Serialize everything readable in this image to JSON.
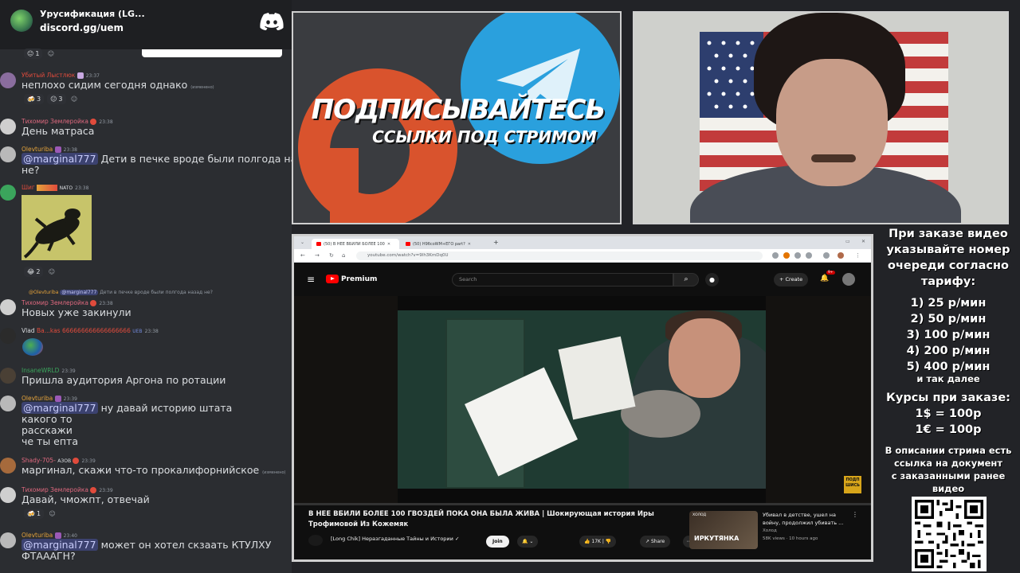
{
  "discord": {
    "server_name": "Урусификация (LG...",
    "invite": "discord.gg/uem",
    "top_reactions": [
      {
        "emoji": "😐",
        "count": "1"
      }
    ],
    "messages": [
      {
        "username": "Убитый Лыстлюк",
        "username_color": "#e04b3c",
        "time": "23:37",
        "text": "неплохо сидим сегодня однако",
        "edited": "(изменено)",
        "reactions": [
          {
            "emoji": "🍻",
            "count": "3"
          },
          {
            "emoji": "😐",
            "count": "3"
          }
        ]
      },
      {
        "username": "Тихомир Землеройка",
        "username_color": "#e0697f",
        "time": "23:38",
        "text": "День матраса"
      },
      {
        "username": "Olevturiba",
        "username_color": "#e5a33b",
        "time": "23:38",
        "mention": "@marginal777",
        "text_line1": "Дети в печке вроде были полгода назад",
        "text_line2": "не?"
      },
      {
        "username": "Шиг",
        "username_color": "#e04b3c",
        "badge": "NATO",
        "time": "23:38",
        "reactions": [
          {
            "emoji": "😂",
            "count": "2"
          }
        ]
      },
      {
        "reply_user": "@Olevturiba",
        "reply_mention": "@marginal777",
        "reply_text": "Дети в печке вроде были полгода назад не?",
        "username": "Тихомир Землеройка",
        "username_color": "#e0697f",
        "time": "23:38",
        "text": "Новых уже закинули"
      },
      {
        "username": "Vlad",
        "username_color": "#dbdee1",
        "username_suffix": "Ba...kas 666666666666666666",
        "badge": "UEB",
        "time": "23:38"
      },
      {
        "username": "InsaneWRLD",
        "username_color": "#3ba55c",
        "time": "23:39",
        "text": "Пришла аудитория Аргона по ротации"
      },
      {
        "username": "Olevturiba",
        "username_color": "#e5a33b",
        "time": "23:39",
        "mention": "@marginal777",
        "text_line1": "ну давай историю штата",
        "text_line2": "какого то",
        "text_line3": "расскажи",
        "text_line4": "че ты епта"
      },
      {
        "username": "Shady-705-",
        "username_color": "#e0697f",
        "badge": "АЗОВ",
        "time": "23:39",
        "text": "маргинал, скажи что-то прокалифорнийское",
        "edited": "(изменено)"
      },
      {
        "username": "Тихомир Землеройка",
        "username_color": "#e0697f",
        "time": "23:39",
        "text": "Давай, чможпт, отвечай",
        "reactions": [
          {
            "emoji": "🍻",
            "count": "1"
          }
        ]
      },
      {
        "username": "Olevturiba",
        "username_color": "#e5a33b",
        "time": "23:40",
        "mention": "@marginal777",
        "text_line1": "может он хотел скзаать КТУЛХУ",
        "text_line2": "ФТАААГН?"
      }
    ]
  },
  "banner": {
    "title": "ПОДПИСЫВАЙТЕСЬ",
    "subtitle": "ССЫЛКИ ПОД СТРИМОМ"
  },
  "browser": {
    "tabs": [
      {
        "label": "(50) В НЕЕ ВБИЛИ БОЛЕЕ 100",
        "active": true
      },
      {
        "label": "(50) Н9бсоWМ+ЕГО part?",
        "active": false
      }
    ],
    "url": "youtube.com/watch?v=9lh3KmDq0U",
    "youtube": {
      "brand": "Premium",
      "search_placeholder": "Search",
      "create_label": "Create",
      "notif_count": "9+",
      "video_title": "В НЕЕ ВБИЛИ БОЛЕЕ 100 ГВОЗДЕЙ ПОКА ОНА БЫЛА ЖИВА | Шокирующая история Иры Трофимовой Из Кожемяк",
      "channel": "[Long Chik] Неразгаданные Тайны и Истории",
      "join_label": "Join",
      "likes": "17K",
      "share_label": "Share",
      "watermark": "ПОДП ШИСЬ",
      "recommendation": {
        "thumb_label": "ИРКУТЯНКА",
        "thumb_top": "ХОЛОД",
        "title": "Убивал в детстве, ушел на войну, продолжил убивать ...",
        "channel": "Холод",
        "meta": "58K views · 10 hours ago"
      }
    }
  },
  "info_panel": {
    "heading_lines": [
      "При заказе видео",
      "указывайте номер",
      "очереди согласно",
      "тарифу:"
    ],
    "tariffs": [
      "1) 25 р/мин",
      "2) 50 р/мин",
      "3) 100 р/мин",
      "4) 200 р/мин",
      "5) 400 р/мин"
    ],
    "tariffs_more": "и так далее",
    "rates_heading": "Курсы при заказе:",
    "rates": [
      "1$ = 100р",
      "1€ = 100р"
    ],
    "note_lines": [
      "В описании стрима есть",
      "ссылка на документ",
      "с заказанными ранее",
      "видео"
    ]
  }
}
